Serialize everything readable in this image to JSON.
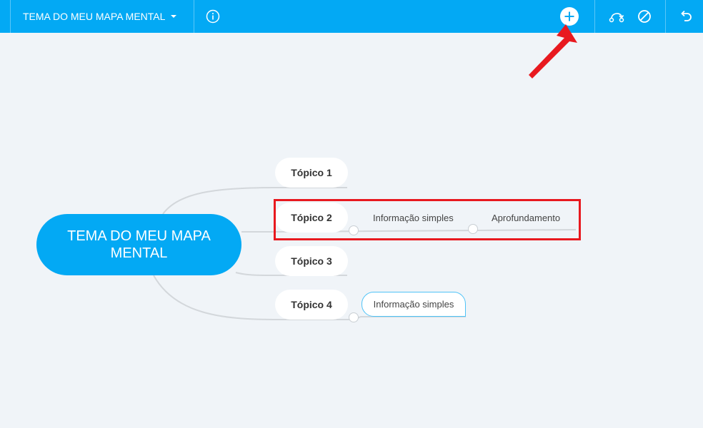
{
  "app": {
    "map_title": "TEMA DO MEU MAPA MENTAL",
    "accent_color": "#03a9f4"
  },
  "toolbar": {
    "info_icon": "info-icon",
    "add_icon": "add-circle-icon",
    "relation_icon": "relation-icon",
    "cancel_icon": "no-entry-icon",
    "undo_icon": "undo-icon"
  },
  "mindmap": {
    "central": "TEMA DO MEU MAPA MENTAL",
    "topics": [
      {
        "label": "Tópico 1"
      },
      {
        "label": "Tópico 2",
        "children": [
          "Informação simples",
          "Aprofundamento"
        ]
      },
      {
        "label": "Tópico 3"
      },
      {
        "label": "Tópico 4",
        "children": [
          "Informação simples"
        ]
      }
    ]
  },
  "annotations": {
    "highlight_color": "#e8191f"
  }
}
